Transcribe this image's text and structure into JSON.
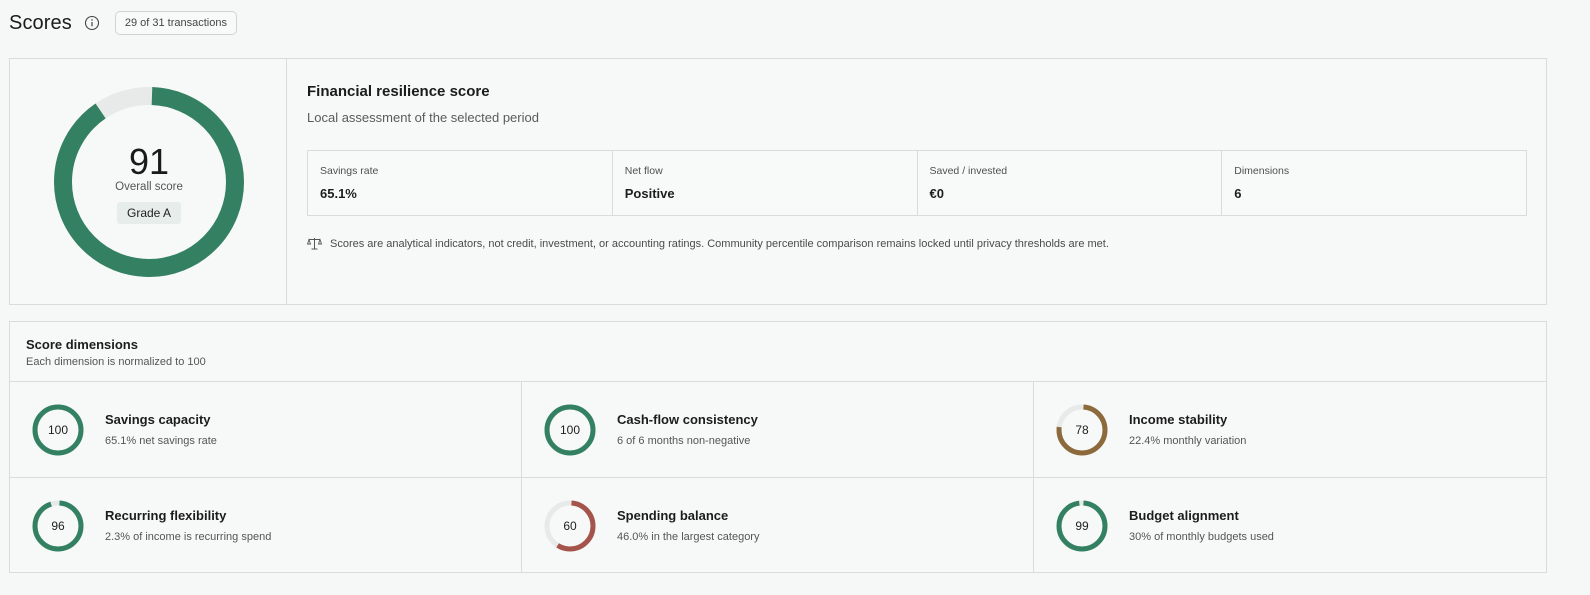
{
  "header": {
    "title": "Scores",
    "info_icon": "info-icon",
    "transactions_badge": "29 of 31 transactions"
  },
  "overall": {
    "score": "91",
    "score_fraction": 0.91,
    "caption": "Overall score",
    "grade": "Grade A",
    "ring_color": "#338062",
    "track_color": "#e8eae9"
  },
  "summary": {
    "title": "Financial resilience score",
    "subtitle": "Local assessment of the selected period",
    "metrics": [
      {
        "label": "Savings rate",
        "value": "65.1%"
      },
      {
        "label": "Net flow",
        "value": "Positive"
      },
      {
        "label": "Saved / invested",
        "value": "€0"
      },
      {
        "label": "Dimensions",
        "value": "6"
      }
    ],
    "disclaimer_icon": "scale-icon",
    "disclaimer": "Scores are analytical indicators, not credit, investment, or accounting ratings. Community percentile comparison remains locked until privacy thresholds are met."
  },
  "dimensions": {
    "title": "Score dimensions",
    "subtitle": "Each dimension is normalized to 100",
    "items": [
      {
        "value": "100",
        "fraction": 1.0,
        "color": "#338062",
        "title": "Savings capacity",
        "desc": "65.1% net savings rate"
      },
      {
        "value": "100",
        "fraction": 1.0,
        "color": "#338062",
        "title": "Cash-flow consistency",
        "desc": "6 of 6 months non-negative"
      },
      {
        "value": "78",
        "fraction": 0.78,
        "color": "#8c6a3c",
        "title": "Income stability",
        "desc": "22.4% monthly variation"
      },
      {
        "value": "96",
        "fraction": 0.96,
        "color": "#338062",
        "title": "Recurring flexibility",
        "desc": "2.3% of income is recurring spend"
      },
      {
        "value": "60",
        "fraction": 0.6,
        "color": "#a5544b",
        "title": "Spending balance",
        "desc": "46.0% in the largest category"
      },
      {
        "value": "99",
        "fraction": 0.99,
        "color": "#338062",
        "title": "Budget alignment",
        "desc": "30% of monthly budgets used"
      }
    ]
  }
}
